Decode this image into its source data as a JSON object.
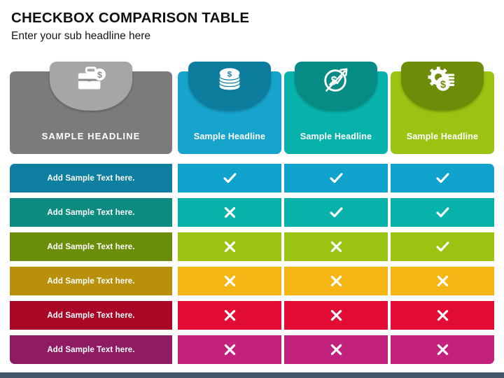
{
  "page": {
    "title": "CHECKBOX COMPARISON TABLE",
    "subtitle": "Enter your sub headline here",
    "bottom_bar_color": "#44546a",
    "background": "#ffffff"
  },
  "table": {
    "headers": [
      {
        "label": "SAMPLE HEADLINE",
        "icon": "briefcase-dollar-icon",
        "body_color": "#7b7b7b",
        "tab_color": "#a6a6a6",
        "is_first_column": true
      },
      {
        "label": "Sample Headline",
        "icon": "coin-stack-dollar-icon",
        "body_color": "#16a3cc",
        "tab_color": "#0d7d9e",
        "is_first_column": false
      },
      {
        "label": "Sample Headline",
        "icon": "dollar-coin-growth-icon",
        "body_color": "#07b2aa",
        "tab_color": "#068b85",
        "is_first_column": false
      },
      {
        "label": "Sample Headline",
        "icon": "gear-coins-icon",
        "body_color": "#9bc311",
        "tab_color": "#6d8d09",
        "is_first_column": false
      }
    ],
    "rows": [
      {
        "label": "Add Sample Text here.",
        "label_color": "#0e7fa0",
        "cell_color": "#0fa2cc",
        "marks": [
          "check",
          "check",
          "check"
        ]
      },
      {
        "label": "Add Sample Text here.",
        "label_color": "#0c8b80",
        "cell_color": "#07b2aa",
        "marks": [
          "cross",
          "check",
          "check"
        ]
      },
      {
        "label": "Add Sample Text here.",
        "label_color": "#6b8e0a",
        "cell_color": "#9bc311",
        "marks": [
          "cross",
          "cross",
          "check"
        ]
      },
      {
        "label": "Add Sample Text here.",
        "label_color": "#b8900c",
        "cell_color": "#f5b615",
        "marks": [
          "cross",
          "cross",
          "cross"
        ]
      },
      {
        "label": "Add Sample Text here.",
        "label_color": "#a80726",
        "cell_color": "#e30c34",
        "marks": [
          "cross",
          "cross",
          "cross"
        ]
      },
      {
        "label": "Add Sample Text here.",
        "label_color": "#8e1b63",
        "cell_color": "#c2227e",
        "marks": [
          "cross",
          "cross",
          "cross"
        ]
      }
    ]
  }
}
